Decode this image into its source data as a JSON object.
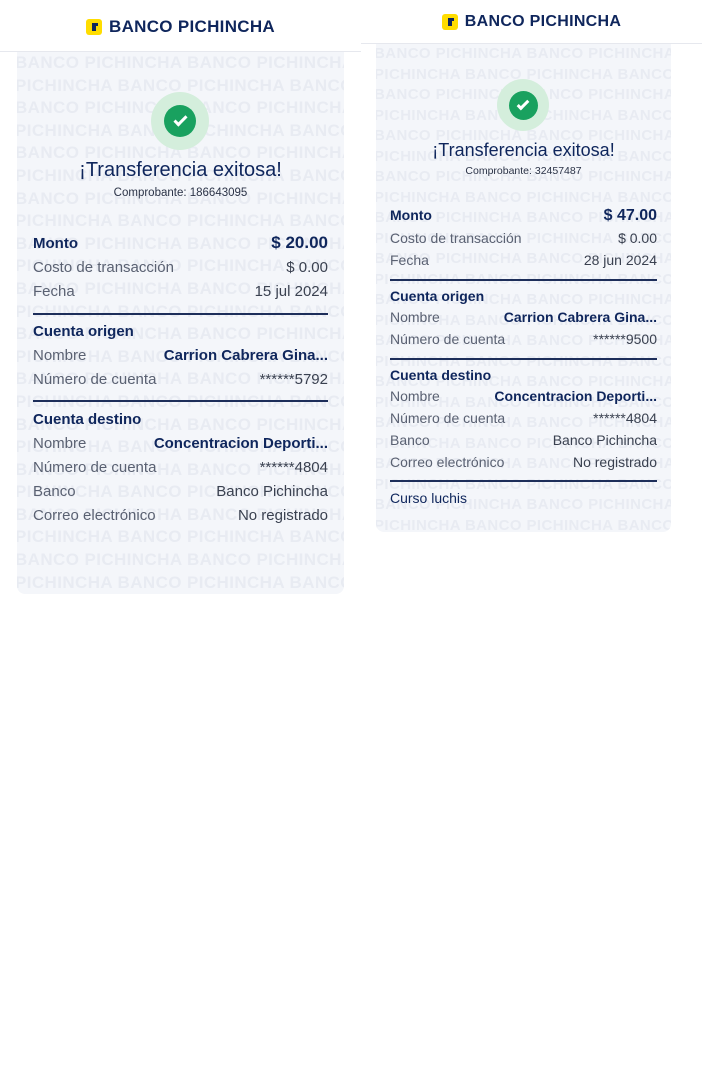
{
  "brand": "BANCO PICHINCHA",
  "watermark_text": "BANCO PICHINCHA",
  "colors": {
    "brand_blue": "#0f265c",
    "brand_yellow": "#ffdd00",
    "success_green": "#19a15f",
    "card_bg": "#f4f6fa"
  },
  "left": {
    "title": "¡Transferencia exitosa!",
    "receipt": "Comprobante: 186643095",
    "amount_label": "Monto",
    "amount": "$ 20.00",
    "fee_label": "Costo de transacción",
    "fee": "$ 0.00",
    "date_label": "Fecha",
    "date": "15 jul 2024",
    "origin": {
      "heading": "Cuenta origen",
      "name_label": "Nombre",
      "name": "Carrion  Cabrera Gina...",
      "account_label": "Número de cuenta",
      "account": "******5792"
    },
    "destination": {
      "heading": "Cuenta destino",
      "name_label": "Nombre",
      "name": "Concentracion Deporti...",
      "account_label": "Número de cuenta",
      "account": "******4804",
      "bank_label": "Banco",
      "bank": "Banco Pichincha",
      "email_label": "Correo electrónico",
      "email": "No registrado"
    }
  },
  "right": {
    "title": "¡Transferencia exitosa!",
    "receipt": "Comprobante: 32457487",
    "amount_label": "Monto",
    "amount": "$ 47.00",
    "fee_label": "Costo de transacción",
    "fee": "$ 0.00",
    "date_label": "Fecha",
    "date": "28 jun 2024",
    "origin": {
      "heading": "Cuenta origen",
      "name_label": "Nombre",
      "name": "Carrion  Cabrera Gina...",
      "account_label": "Número de cuenta",
      "account": "******9500"
    },
    "destination": {
      "heading": "Cuenta destino",
      "name_label": "Nombre",
      "name": "Concentracion Deporti...",
      "account_label": "Número de cuenta",
      "account": "******4804",
      "bank_label": "Banco",
      "bank": "Banco Pichincha",
      "email_label": "Correo electrónico",
      "email": "No registrado"
    },
    "description": "Curso luchis"
  }
}
